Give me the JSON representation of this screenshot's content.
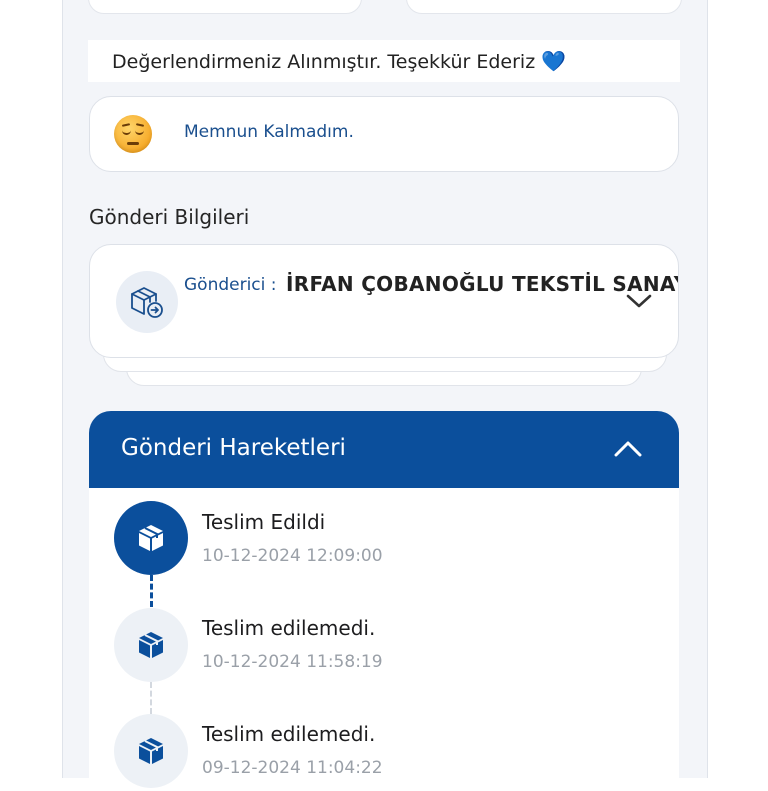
{
  "feedback": {
    "thanks_text": "Değerlendirmeniz Alınmıştır. Teşekkür Ederiz",
    "heart": "💙",
    "rating_label": "Memnun Kalmadım.",
    "rating_icon": "sad-face-emoji"
  },
  "shipment_info": {
    "section_title": "Gönderi Bilgileri",
    "sender_label": "Gönderici :",
    "sender_name": "İRFAN ÇOBANOĞLU TEKSTİL SANAYİ ..."
  },
  "movements": {
    "title": "Gönderi Hareketleri",
    "steps": [
      {
        "title": "Teslim Edildi",
        "date": "10-12-2024 12:09:00",
        "active": true
      },
      {
        "title": "Teslim edilemedi.",
        "date": "10-12-2024 11:58:19",
        "active": false
      },
      {
        "title": "Teslim edilemedi.",
        "date": "09-12-2024 11:04:22",
        "active": false
      }
    ]
  },
  "colors": {
    "brand_blue": "#0b4f9c",
    "label_blue": "#1a4f8e",
    "muted_text": "#9aa0a8",
    "panel_bg": "#f3f5f9"
  }
}
